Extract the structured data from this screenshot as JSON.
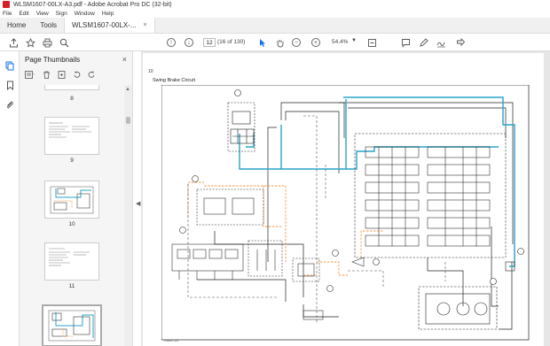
{
  "window": {
    "title": "WLSM1607-00LX-A3.pdf - Adobe Acrobat Pro DC (32-bit)"
  },
  "menu": [
    "File",
    "Edit",
    "View",
    "Sign",
    "Window",
    "Help"
  ],
  "tabs": {
    "home": "Home",
    "tools": "Tools",
    "document": "WLSM1607-00LX-...",
    "close": "×"
  },
  "toolbar": {
    "page_value": "12",
    "page_count": "(16 of 130)",
    "zoom": "54.4%",
    "icons": [
      "upload-icon",
      "bookmark-star-icon",
      "print-icon",
      "search-icon",
      "prev-page-icon",
      "next-page-icon",
      "select-arrow-icon",
      "hand-icon",
      "zoom-out-icon",
      "zoom-in-icon",
      "fit-page-icon",
      "comment-icon",
      "pen-icon",
      "sign-icon",
      "share-icon"
    ]
  },
  "sidebar": {
    "header": "Page Thumbnails",
    "close": "×",
    "thumbnails": [
      {
        "label": "8"
      },
      {
        "label": "9"
      },
      {
        "label": "10"
      },
      {
        "label": "11"
      },
      {
        "label": ""
      }
    ]
  },
  "page": {
    "number": "10",
    "title": "Swing Brake Circuit",
    "footnote": "0384172A"
  },
  "colors": {
    "accent": "#1473e6",
    "hydraulic_blue": "#29a3c9",
    "pilot_orange": "#f39a47",
    "adobe_red": "#d61f26"
  }
}
